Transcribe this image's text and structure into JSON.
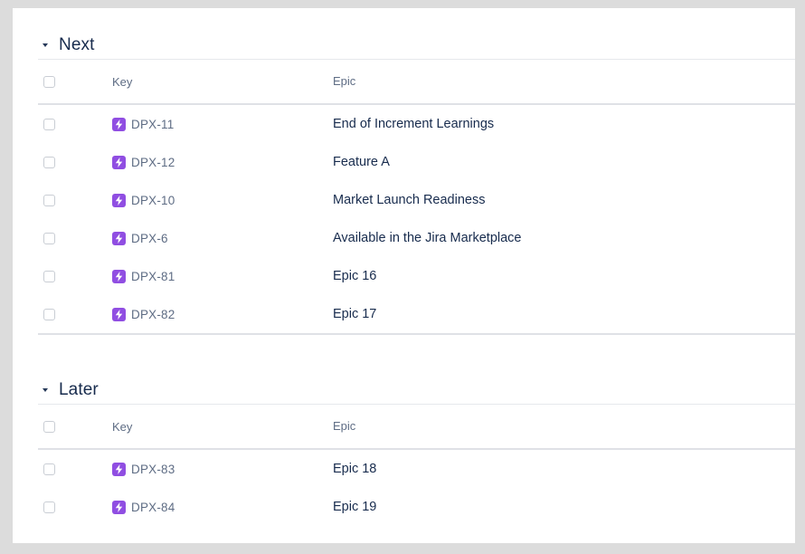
{
  "colors": {
    "epic_icon": "#904ee2",
    "heading": "#172b4d",
    "muted": "#5e6c84",
    "divider": "#dfe1e6"
  },
  "icons": {
    "collapse": "chevron-down-icon",
    "epic": "epic-lightning-icon"
  },
  "sections": [
    {
      "title": "Next",
      "columns": {
        "key": "Key",
        "epic": "Epic"
      },
      "rows": [
        {
          "key": "DPX-11",
          "epic": "End of Increment Learnings"
        },
        {
          "key": "DPX-12",
          "epic": "Feature A"
        },
        {
          "key": "DPX-10",
          "epic": "Market Launch Readiness"
        },
        {
          "key": "DPX-6",
          "epic": "Available in the Jira Marketplace"
        },
        {
          "key": "DPX-81",
          "epic": "Epic 16"
        },
        {
          "key": "DPX-82",
          "epic": "Epic 17"
        }
      ]
    },
    {
      "title": "Later",
      "columns": {
        "key": "Key",
        "epic": "Epic"
      },
      "rows": [
        {
          "key": "DPX-83",
          "epic": "Epic 18"
        },
        {
          "key": "DPX-84",
          "epic": "Epic 19"
        }
      ]
    }
  ]
}
